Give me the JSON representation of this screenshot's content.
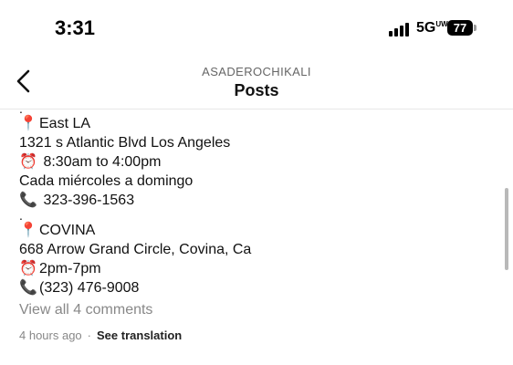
{
  "status_bar": {
    "time": "3:31",
    "network": "5G",
    "network_sup": "UW",
    "battery": "77"
  },
  "header": {
    "subtitle": "ASADEROCHIKALI",
    "title": "Posts"
  },
  "caption": {
    "lines": [
      {
        "kind": "dot",
        "icon": "",
        "text": "."
      },
      {
        "kind": "text",
        "icon": "📍",
        "text": "East LA"
      },
      {
        "kind": "text",
        "icon": "",
        "text": "1321 s Atlantic Blvd Los Angeles"
      },
      {
        "kind": "text",
        "icon": "⏰",
        "text": " 8:30am to 4:00pm"
      },
      {
        "kind": "text",
        "icon": "",
        "text": "Cada miércoles a domingo"
      },
      {
        "kind": "text",
        "icon": "📞",
        "text": " 323-396-1563"
      },
      {
        "kind": "dot",
        "icon": "",
        "text": "."
      },
      {
        "kind": "text",
        "icon": "📍",
        "text": "COVINA"
      },
      {
        "kind": "text",
        "icon": "",
        "text": "668 Arrow Grand Circle, Covina, Ca"
      },
      {
        "kind": "text",
        "icon": "⏰",
        "text": "2pm-7pm"
      },
      {
        "kind": "text",
        "icon": "📞",
        "text": "(323) 476-9008"
      }
    ]
  },
  "comments": {
    "label": "View all 4 comments"
  },
  "meta": {
    "time_ago": "4 hours ago",
    "separator": "·",
    "translate_label": "See translation"
  }
}
